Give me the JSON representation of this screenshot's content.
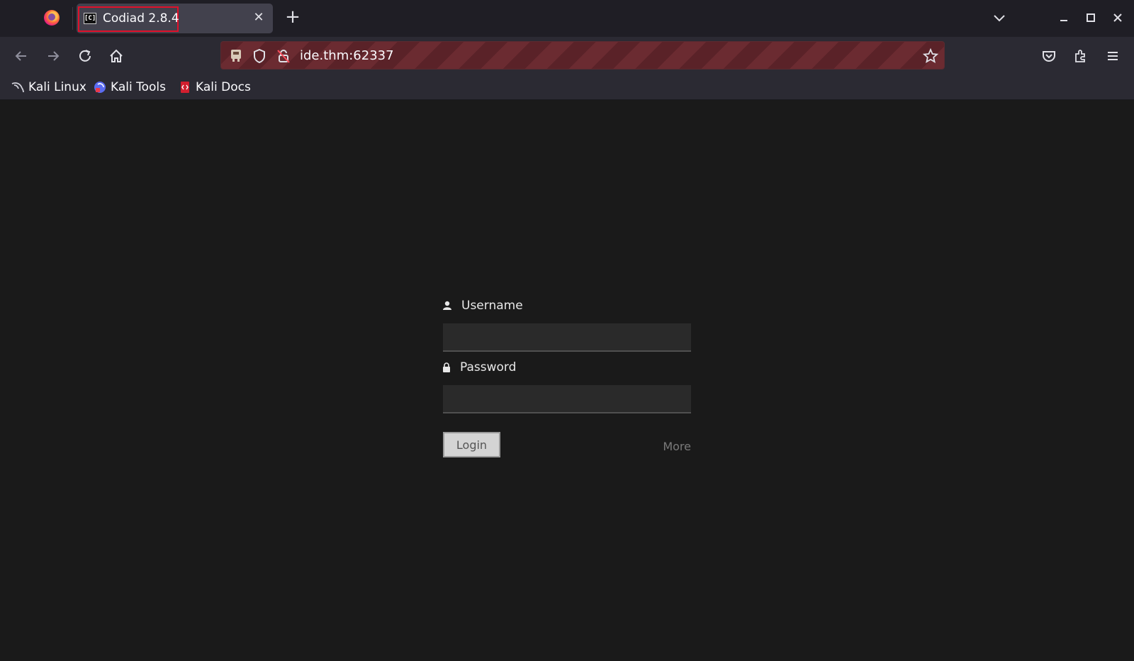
{
  "browser": {
    "tab": {
      "title": "Codiad 2.8.4",
      "favicon_text": "[C]"
    },
    "url": "ide.thm:62337",
    "bookmarks": [
      {
        "label": "Kali Linux",
        "icon": "kali-dragon-icon"
      },
      {
        "label": "Kali Tools",
        "icon": "kali-tools-icon"
      },
      {
        "label": "Kali Docs",
        "icon": "kali-docs-icon"
      }
    ]
  },
  "login": {
    "username_label": "Username",
    "username_value": "",
    "password_label": "Password",
    "password_value": "",
    "login_button": "Login",
    "more_link": "More"
  },
  "colors": {
    "tab_highlight": "#e0102a",
    "urlbar_stripe": "#5a2228",
    "page_background": "#1a1a1a"
  }
}
